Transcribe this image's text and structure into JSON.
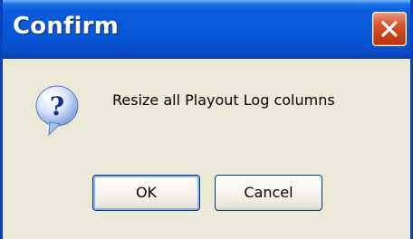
{
  "dialog": {
    "title": "Confirm",
    "message": "Resize all Playout Log columns",
    "icon": "question-icon",
    "buttons": {
      "ok_label": "OK",
      "cancel_label": "Cancel"
    }
  },
  "colors": {
    "titlebar": "#0859d8",
    "frame": "#0842b8",
    "body": "#ece9d8",
    "close_button": "#c63e14",
    "default_button_focus": "#8fb3ed"
  }
}
